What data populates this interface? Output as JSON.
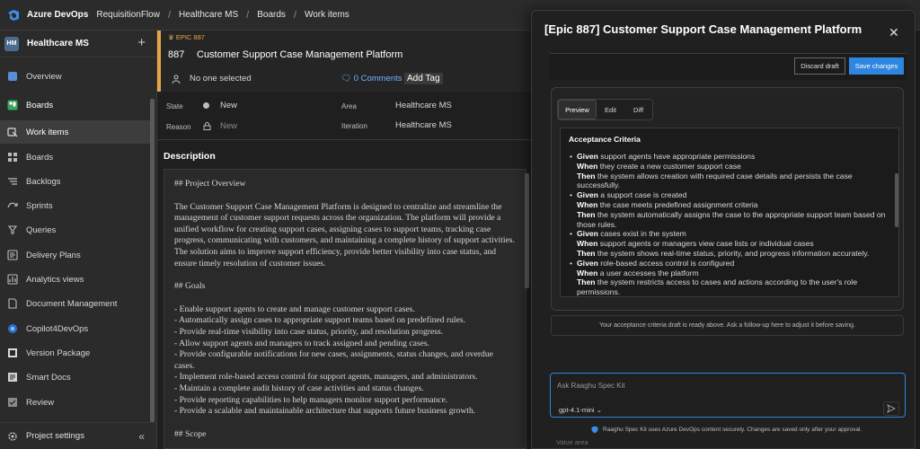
{
  "topbar": {
    "brand": "Azure DevOps",
    "breadcrumbs": [
      "RequisitionFlow",
      "Healthcare MS",
      "Boards",
      "Work items"
    ]
  },
  "sidebar": {
    "project_avatar": "HM",
    "project_name": "Healthcare MS",
    "items": [
      {
        "label": "Overview",
        "icon": "overview-icon"
      },
      {
        "label": "Boards",
        "icon": "boards-section-icon"
      },
      {
        "label": "Work items",
        "icon": "work-items-icon"
      },
      {
        "label": "Boards",
        "icon": "boards-icon"
      },
      {
        "label": "Backlogs",
        "icon": "backlogs-icon"
      },
      {
        "label": "Sprints",
        "icon": "sprints-icon"
      },
      {
        "label": "Queries",
        "icon": "queries-icon"
      },
      {
        "label": "Delivery Plans",
        "icon": "delivery-plans-icon"
      },
      {
        "label": "Analytics views",
        "icon": "analytics-icon"
      },
      {
        "label": "Document Management",
        "icon": "document-icon"
      },
      {
        "label": "Copilot4DevOps",
        "icon": "copilot-icon"
      },
      {
        "label": "Version Package",
        "icon": "package-icon"
      },
      {
        "label": "Smart Docs",
        "icon": "smart-docs-icon"
      },
      {
        "label": "Review",
        "icon": "review-icon"
      }
    ],
    "footer_label": "Project settings",
    "collapse_glyph": "«"
  },
  "workitem": {
    "type_tag": "EPIC 887",
    "id": "887",
    "title": "Customer Support Case Management Platform",
    "assigned": "No one selected",
    "comments": "0 Comments",
    "add_tag": "Add Tag",
    "fields": {
      "state_label": "State",
      "state_value": "New",
      "reason_label": "Reason",
      "reason_value": "New",
      "area_label": "Area",
      "area_value": "Healthcare MS",
      "iteration_label": "Iteration",
      "iteration_value": "Healthcare MS"
    },
    "description_heading": "Description",
    "description": {
      "overview_heading": "## Project Overview",
      "overview_text": "The Customer Support Case Management Platform is designed to centralize and streamline the management of customer support requests across the organization. The platform will provide a unified workflow for creating support cases, assigning cases to support teams, tracking case progress, communicating with customers, and maintaining a complete history of support activities. The solution aims to improve support efficiency, provide better visibility into case status, and ensure timely resolution of customer issues.",
      "goals_heading": "## Goals",
      "goals": [
        "- Enable support agents to create and manage customer support cases.",
        "- Automatically assign cases to appropriate support teams based on predefined rules.",
        "- Provide real-time visibility into case status, priority, and resolution progress.",
        "- Allow support agents and managers to track assigned and pending cases.",
        "- Provide configurable notifications for new cases, assignments, status changes, and overdue cases.",
        "- Implement role-based access control for support agents, managers, and administrators.",
        "- Maintain a complete audit history of case activities and status changes.",
        "- Provide reporting capabilities to help managers monitor support performance.",
        "- Provide a scalable and maintainable architecture that supports future business growth."
      ],
      "scope_heading": "## Scope"
    }
  },
  "dialog": {
    "title": "[Epic 887] Customer Support Case Management Platform",
    "close_glyph": "✕",
    "discard_label": "Discard draft",
    "save_label": "Save changes",
    "tabs": [
      "Preview",
      "Edit",
      "Diff"
    ],
    "active_tab": "Preview",
    "criteria_heading": "Acceptance Criteria",
    "criteria": [
      {
        "given": "support agents have appropriate permissions",
        "when": "they create a new customer support case",
        "then": "the system allows creation with required case details and persists the case successfully."
      },
      {
        "given": "a support case is created",
        "when": "the case meets predefined assignment criteria",
        "then": "the system automatically assigns the case to the appropriate support team based on those rules."
      },
      {
        "given": "cases exist in the system",
        "when": "support agents or managers view case lists or individual cases",
        "then": "the system shows real-time status, priority, and progress information accurately."
      },
      {
        "given": "role-based access control is configured",
        "when": "a user accesses the platform",
        "then": "the system restricts access to cases and actions according to the user's role permissions."
      }
    ],
    "kw_given": "Given",
    "kw_when": "When",
    "kw_then": "Then",
    "notice": "Your acceptance criteria draft is ready above. Ask a follow-up here to adjust it before saving.",
    "ask_placeholder": "Ask Raaghu Spec Kit",
    "model": "gpt-4.1-mini",
    "footnote": "Raaghu Spec Kit uses Azure DevOps content securely. Changes are saved only after your approval.",
    "value_area": "Value area"
  },
  "colors": {
    "accent": "#2f86e0",
    "epic": "#e8a64b",
    "link": "#6fb3ff"
  }
}
